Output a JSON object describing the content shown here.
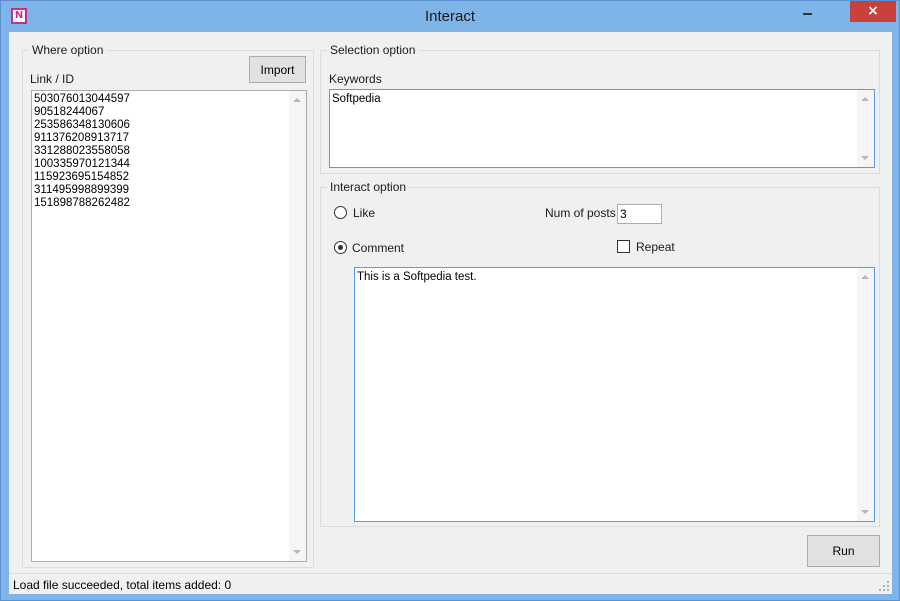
{
  "window": {
    "title": "Interact",
    "icon": "app-icon",
    "icon_glyph": "N",
    "controls": {
      "minimize": "minimize-icon",
      "close": "×"
    }
  },
  "where_option": {
    "group_label": "Where option",
    "link_label": "Link / ID",
    "import_button": "Import",
    "links": "503076013044597\n90518244067\n253586348130606\n911376208913717\n331288023558058\n100335970121344\n115923695154852\n311495998899399\n151898788262482"
  },
  "selection_option": {
    "group_label": "Selection option",
    "keywords_label": "Keywords",
    "keywords_value": "Softpedia"
  },
  "interact_option": {
    "group_label": "Interact option",
    "like_label": "Like",
    "like_checked": false,
    "comment_label": "Comment",
    "comment_checked": true,
    "num_posts_label": "Num of posts",
    "num_posts_value": "3",
    "repeat_label": "Repeat",
    "repeat_checked": false,
    "comment_text": "This is a Softpedia test."
  },
  "run_button": "Run",
  "status": {
    "text": "Load file succeeded, total items added: 0"
  },
  "colors": {
    "titlebar": "#7fb4e8",
    "close_button": "#c7423a",
    "app_icon_accent": "#c2308f",
    "focus_border": "#569de5"
  }
}
